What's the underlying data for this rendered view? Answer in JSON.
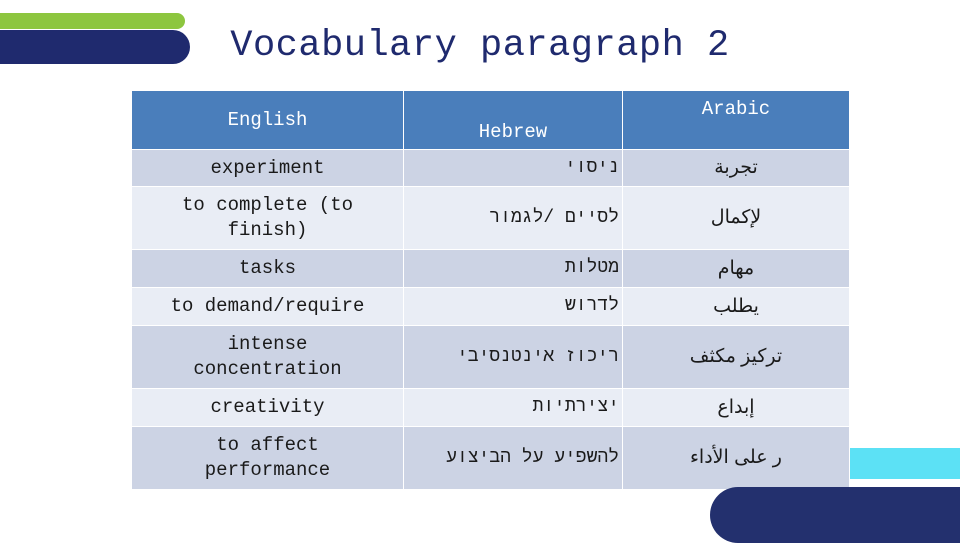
{
  "slide": {
    "title": "Vocabulary paragraph 2"
  },
  "decorations": {
    "green_bar": "green-accent-bar",
    "navy_bar": "navy-accent-bar",
    "cyan_rect": "cyan-accent-rectangle",
    "navy_pill": "navy-accent-pill",
    "colors": {
      "green": "#8dc63f",
      "navy": "#1f2a6e",
      "cyan": "#5ce1f5",
      "navy_pill": "#23306e",
      "header_blue": "#4a7ebb",
      "row_dark": "#ccd3e4",
      "row_light": "#e9edf5"
    }
  },
  "table": {
    "headers": {
      "english": "English",
      "hebrew": "Hebrew",
      "arabic": "Arabic"
    },
    "rows": [
      {
        "english": "experiment",
        "english_lines": [
          "experiment"
        ],
        "hebrew": "ניסוי",
        "arabic": "تجربة"
      },
      {
        "english": "to complete (to finish)",
        "english_lines": [
          "to complete (to",
          "finish)"
        ],
        "hebrew": "לסיים /לגמור",
        "arabic": "لإكمال"
      },
      {
        "english": "tasks",
        "english_lines": [
          "tasks"
        ],
        "hebrew": "מטלות",
        "arabic": "مهام"
      },
      {
        "english": "to demand/require",
        "english_lines": [
          "to demand/require"
        ],
        "hebrew": "לדרוש",
        "arabic": "يطلب"
      },
      {
        "english": "intense concentration",
        "english_lines": [
          "intense",
          "concentration"
        ],
        "hebrew": "ריכוז אינטנסיבי",
        "arabic": "تركيز مكثف"
      },
      {
        "english": "creativity",
        "english_lines": [
          "creativity"
        ],
        "hebrew": "יצירתיות",
        "arabic": "إبداع"
      },
      {
        "english": "to affect performance",
        "english_lines": [
          "to affect",
          "performance"
        ],
        "hebrew": "להשפיע על הביצוע",
        "arabic": "ر على الأداء"
      }
    ]
  }
}
